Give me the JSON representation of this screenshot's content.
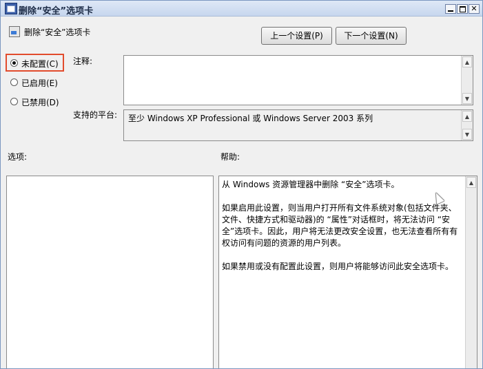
{
  "window": {
    "title": "删除“安全”选项卡"
  },
  "header": {
    "policy_title": "删除“安全”选项卡",
    "prev_button": "上一个设置(P)",
    "next_button": "下一个设置(N)"
  },
  "state": {
    "options": [
      {
        "label": "未配置(C)",
        "checked": true
      },
      {
        "label": "已启用(E)",
        "checked": false
      },
      {
        "label": "已禁用(D)",
        "checked": false
      }
    ]
  },
  "comment": {
    "label": "注释:",
    "value": ""
  },
  "platform": {
    "label": "支持的平台:",
    "value": "至少 Windows XP Professional 或 Windows Server 2003 系列"
  },
  "options_panel": {
    "label": "选项:"
  },
  "help_panel": {
    "label": "帮助:",
    "paragraphs": [
      "从 Windows 资源管理器中删除 “安全”选项卡。",
      "如果启用此设置，则当用户打开所有文件系统对象(包括文件夹、文件、快捷方式和驱动器)的 “属性”对话框时，将无法访问 “安全”选项卡。因此，用户将无法更改安全设置，也无法查看所有有权访问有问题的资源的用户列表。",
      "如果禁用或没有配置此设置，则用户将能够访问此安全选项卡。"
    ]
  },
  "icons": {
    "title_icon": "policy-icon",
    "header_icon": "policy-setting-icon"
  }
}
